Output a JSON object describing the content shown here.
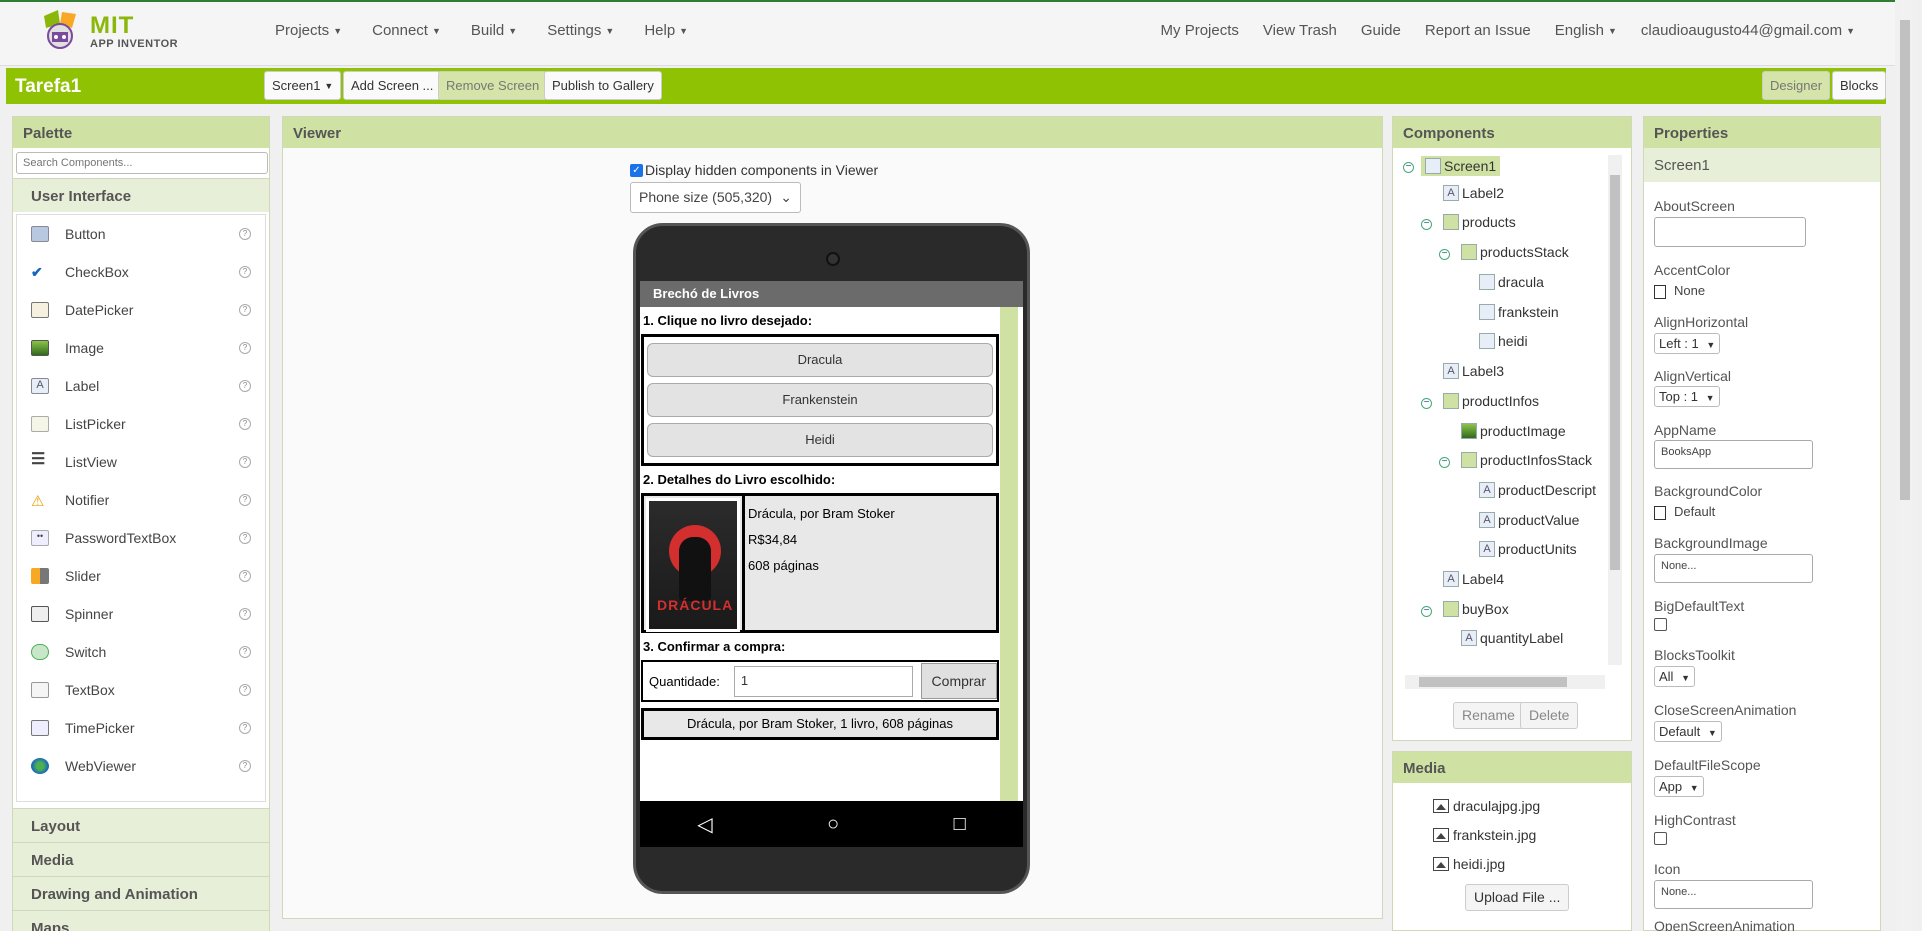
{
  "topbar": {
    "logo_mit": "MIT",
    "logo_sub": "APP INVENTOR",
    "left_menu": [
      "Projects",
      "Connect",
      "Build",
      "Settings",
      "Help"
    ],
    "my_projects": "My Projects",
    "view_trash": "View Trash",
    "guide": "Guide",
    "report": "Report an Issue",
    "language": "English",
    "account": "claudioaugusto44@gmail.com"
  },
  "toolbar": {
    "project_name": "Tarefa1",
    "screen_select": "Screen1",
    "add_screen": "Add Screen ...",
    "remove_screen": "Remove Screen",
    "publish": "Publish to Gallery",
    "designer": "Designer",
    "blocks": "Blocks"
  },
  "palette": {
    "title": "Palette",
    "search_placeholder": "Search Components...",
    "ui_section": "User Interface",
    "items": [
      "Button",
      "CheckBox",
      "DatePicker",
      "Image",
      "Label",
      "ListPicker",
      "ListView",
      "Notifier",
      "PasswordTextBox",
      "Slider",
      "Spinner",
      "Switch",
      "TextBox",
      "TimePicker",
      "WebViewer"
    ],
    "sections": [
      "Layout",
      "Media",
      "Drawing and Animation",
      "Maps"
    ]
  },
  "viewer": {
    "title": "Viewer",
    "show_hidden": "Display hidden components in Viewer",
    "phone_size": "Phone size (505,320)",
    "app": {
      "title": "Brechó de Livros",
      "step1": "1. Clique no livro desejado:",
      "buttons": [
        "Dracula",
        "Frankenstein",
        "Heidi"
      ],
      "step2": "2. Detalhes do Livro escolhido:",
      "cover_text": "DRÁCULA",
      "description": "Drácula, por Bram Stoker",
      "price": "R$34,84",
      "pages": "608 páginas",
      "step3": "3. Confirmar a compra:",
      "quantity_label": "Quantidade:",
      "quantity_value": "1",
      "buy_button": "Comprar",
      "summary": "Drácula, por Bram Stoker, 1 livro, 608 páginas"
    }
  },
  "components": {
    "title": "Components",
    "tree": [
      "Screen1",
      "Label2",
      "products",
      "productsStack",
      "dracula",
      "frankstein",
      "heidi",
      "Label3",
      "productInfos",
      "productImage",
      "productInfosStack",
      "productDescript",
      "productValue",
      "productUnits",
      "Label4",
      "buyBox",
      "quantityLabel"
    ],
    "rename": "Rename",
    "delete": "Delete"
  },
  "media": {
    "title": "Media",
    "files": [
      "draculajpg.jpg",
      "frankstein.jpg",
      "heidi.jpg"
    ],
    "upload": "Upload File ..."
  },
  "properties": {
    "title": "Properties",
    "screen": "Screen1",
    "about_label": "AboutScreen",
    "accent_label": "AccentColor",
    "accent_value": "None",
    "alignh_label": "AlignHorizontal",
    "alignh_value": "Left : 1",
    "alignv_label": "AlignVertical",
    "alignv_value": "Top : 1",
    "appname_label": "AppName",
    "appname_value": "BooksApp",
    "bgcolor_label": "BackgroundColor",
    "bgcolor_value": "Default",
    "bgimage_label": "BackgroundImage",
    "bgimage_value": "None...",
    "bigtext_label": "BigDefaultText",
    "toolkit_label": "BlocksToolkit",
    "toolkit_value": "All",
    "closeanim_label": "CloseScreenAnimation",
    "closeanim_value": "Default",
    "filescope_label": "DefaultFileScope",
    "filescope_value": "App",
    "contrast_label": "HighContrast",
    "icon_label": "Icon",
    "icon_value": "None...",
    "openanim_label": "OpenScreenAnimation"
  }
}
